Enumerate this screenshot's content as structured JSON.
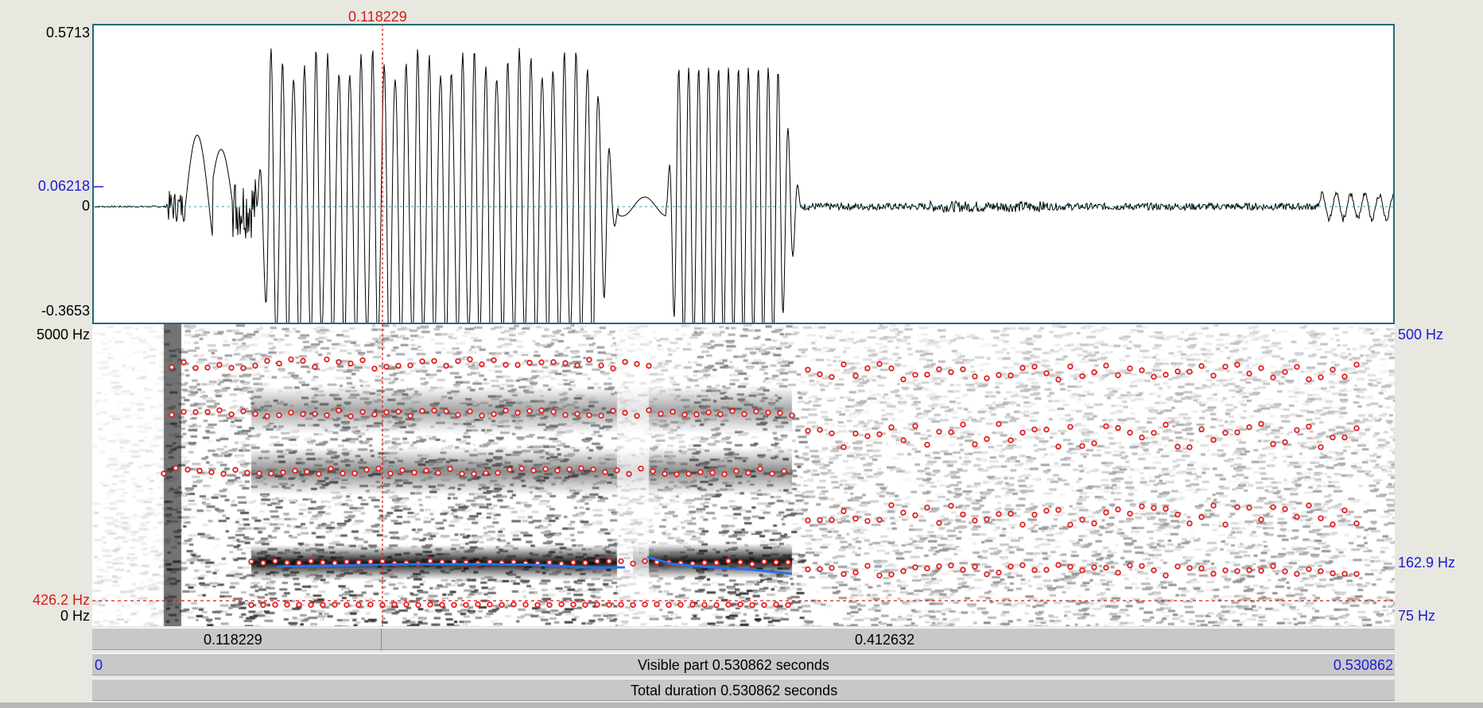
{
  "cursor": {
    "time_label": "0.118229"
  },
  "waveform": {
    "y_max_label": "0.5713",
    "y_cursor_label": "0.06218",
    "y_zero_label": "0",
    "y_min_label": "-0.3653"
  },
  "spectrogram": {
    "freq_top_label": "5000 Hz",
    "freq_cursor_label": "426.2 Hz",
    "freq_bottom_label": "0 Hz",
    "pitch_top_label": "500 Hz",
    "pitch_mid_label": "162.9 Hz",
    "pitch_bottom_label": "75 Hz"
  },
  "time_bar": {
    "segment_left_label": "0.118229",
    "segment_right_label": "0.412632"
  },
  "visible_bar": {
    "start_label": "0",
    "center_label": "Visible part 0.530862 seconds",
    "end_label": "0.530862"
  },
  "total_bar": {
    "label": "Total duration 0.530862 seconds"
  },
  "colors": {
    "cursor": "#d71a1a",
    "pitch": "#1a1ad7",
    "formant_dots": "#e02020",
    "pitch_line": "#2a6fe0",
    "waveform_border": "#1f6b78"
  }
}
